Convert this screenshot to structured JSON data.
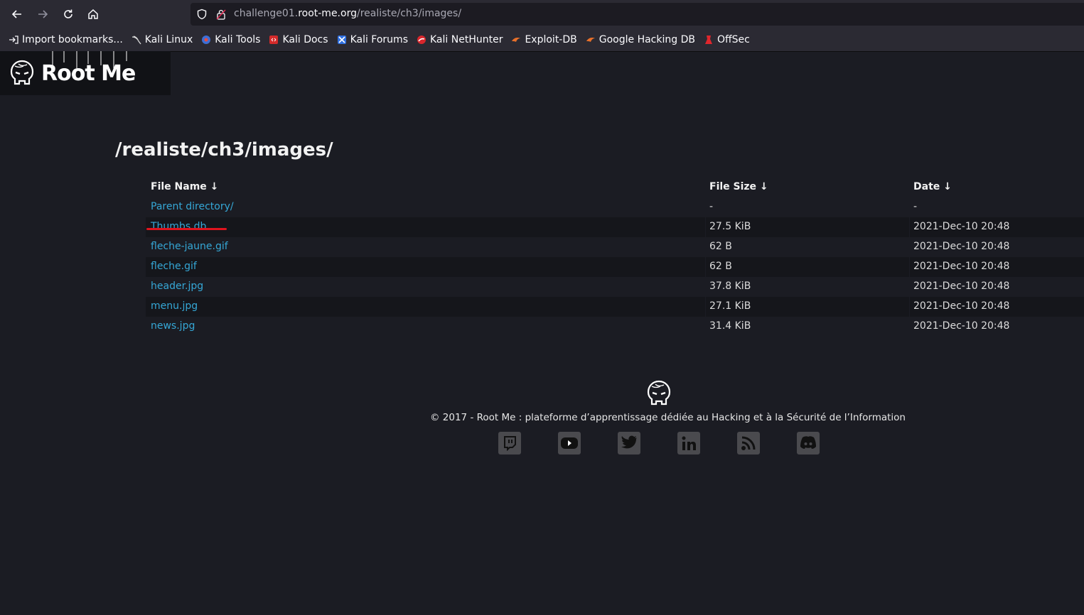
{
  "browser": {
    "url_host": "challenge01.root-me.org",
    "url_path": "/realiste/ch3/images/",
    "bookmarks": [
      {
        "label": "Import bookmarks...",
        "icon": "import-icon"
      },
      {
        "label": "Kali Linux",
        "icon": "kali-dragon-icon"
      },
      {
        "label": "Kali Tools",
        "icon": "kali-tools-icon"
      },
      {
        "label": "Kali Docs",
        "icon": "kali-docs-icon"
      },
      {
        "label": "Kali Forums",
        "icon": "kali-forums-icon"
      },
      {
        "label": "Kali NetHunter",
        "icon": "kali-nethunter-icon"
      },
      {
        "label": "Exploit-DB",
        "icon": "exploit-db-icon"
      },
      {
        "label": "Google Hacking DB",
        "icon": "ghdb-icon"
      },
      {
        "label": "OffSec",
        "icon": "offsec-icon"
      }
    ]
  },
  "site": {
    "logo_text": "Root Me"
  },
  "page": {
    "title": "/realiste/ch3/images/",
    "columns": {
      "name": "File Name  ↓",
      "size": "File Size  ↓",
      "date": "Date  ↓"
    },
    "files": [
      {
        "name": "Parent directory/",
        "size": "-",
        "date": "-"
      },
      {
        "name": "Thumbs.db",
        "size": "27.5 KiB",
        "date": "2021-Dec-10 20:48"
      },
      {
        "name": "fleche-jaune.gif",
        "size": "62 B",
        "date": "2021-Dec-10 20:48"
      },
      {
        "name": "fleche.gif",
        "size": "62 B",
        "date": "2021-Dec-10 20:48"
      },
      {
        "name": "header.jpg",
        "size": "37.8 KiB",
        "date": "2021-Dec-10 20:48"
      },
      {
        "name": "menu.jpg",
        "size": "27.1 KiB",
        "date": "2021-Dec-10 20:48"
      },
      {
        "name": "news.jpg",
        "size": "31.4 KiB",
        "date": "2021-Dec-10 20:48"
      }
    ]
  },
  "footer": {
    "copyright": "© 2017 - Root Me : plateforme d’apprentissage dédiée au Hacking et à la Sécurité de l’Information",
    "social": [
      "twitch-icon",
      "youtube-icon",
      "twitter-icon",
      "linkedin-icon",
      "rss-icon",
      "discord-icon"
    ]
  },
  "colors": {
    "background": "#1b1c23",
    "link": "#35a7d6",
    "highlight": "#e0141e"
  }
}
